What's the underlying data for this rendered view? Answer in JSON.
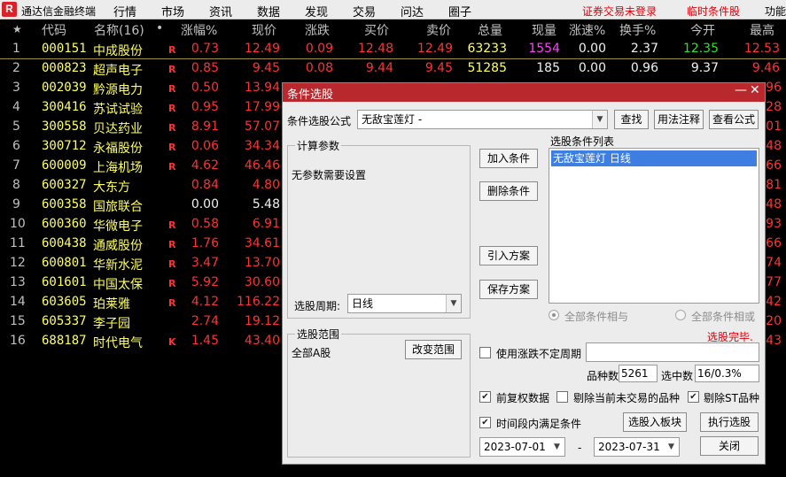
{
  "app": {
    "title": "通达信金融终端",
    "logo": "R",
    "menu": [
      "行情",
      "市场",
      "资讯",
      "数据",
      "发现",
      "交易",
      "问达",
      "圈子"
    ],
    "status_login": "证券交易未登录",
    "status_condition": "临时条件股",
    "func": "功能"
  },
  "table": {
    "columns": {
      "star": "★",
      "code": "代码",
      "name": "名称(16)",
      "dot": "•",
      "change_pct": "涨幅%",
      "price": "现价",
      "change": "涨跌",
      "bid": "买价",
      "ask": "卖价",
      "volume": "总量",
      "current_vol": "现量",
      "speed": "涨速%",
      "turnover": "换手%",
      "open": "今开",
      "high": "最高"
    },
    "rows": [
      {
        "idx": "1",
        "code": "000151",
        "name": "中成股份",
        "flag": "R",
        "pct": "0.73",
        "price": "12.49",
        "chg": "0.09",
        "bid": "12.48",
        "ask": "12.49",
        "vol": "63233",
        "cur": "1554",
        "speed": "0.00",
        "turn": "2.37",
        "open": "12.35",
        "high": "12.53"
      },
      {
        "idx": "2",
        "code": "000823",
        "name": "超声电子",
        "flag": "R",
        "pct": "0.85",
        "price": "9.45",
        "chg": "0.08",
        "bid": "9.44",
        "ask": "9.45",
        "vol": "51285",
        "cur": "185",
        "speed": "0.00",
        "turn": "0.96",
        "open": "9.37",
        "high": "9.46"
      },
      {
        "idx": "3",
        "code": "002039",
        "name": "黔源电力",
        "flag": "R",
        "pct": "0.50",
        "price": "13.94",
        "high": "96"
      },
      {
        "idx": "4",
        "code": "300416",
        "name": "苏试试验",
        "flag": "R",
        "pct": "0.95",
        "price": "17.99",
        "high": "28"
      },
      {
        "idx": "5",
        "code": "300558",
        "name": "贝达药业",
        "flag": "R",
        "pct": "8.91",
        "price": "57.07",
        "high": "01"
      },
      {
        "idx": "6",
        "code": "300712",
        "name": "永福股份",
        "flag": "R",
        "pct": "0.06",
        "price": "34.34",
        "high": "48"
      },
      {
        "idx": "7",
        "code": "600009",
        "name": "上海机场",
        "flag": "R",
        "pct": "4.62",
        "price": "46.46",
        "high": "66"
      },
      {
        "idx": "8",
        "code": "600327",
        "name": "大东方",
        "flag": "",
        "pct": "0.84",
        "price": "4.80",
        "high": "81"
      },
      {
        "idx": "9",
        "code": "600358",
        "name": "国旅联合",
        "flag": "",
        "pct": "0.00",
        "price": "5.48",
        "high": "48"
      },
      {
        "idx": "10",
        "code": "600360",
        "name": "华微电子",
        "flag": "R",
        "pct": "0.58",
        "price": "6.91",
        "high": "93"
      },
      {
        "idx": "11",
        "code": "600438",
        "name": "通威股份",
        "flag": "R",
        "pct": "1.76",
        "price": "34.61",
        "high": "66"
      },
      {
        "idx": "12",
        "code": "600801",
        "name": "华新水泥",
        "flag": "R",
        "pct": "3.47",
        "price": "13.70",
        "high": "74"
      },
      {
        "idx": "13",
        "code": "601601",
        "name": "中国太保",
        "flag": "R",
        "pct": "5.92",
        "price": "30.60",
        "high": "77"
      },
      {
        "idx": "14",
        "code": "603605",
        "name": "珀莱雅",
        "flag": "R",
        "pct": "4.12",
        "price": "116.22",
        "high": "42"
      },
      {
        "idx": "15",
        "code": "605337",
        "name": "李子园",
        "flag": "",
        "pct": "2.74",
        "price": "19.12",
        "high": "20"
      },
      {
        "idx": "16",
        "code": "688187",
        "name": "时代电气",
        "flag": "K",
        "pct": "1.45",
        "price": "43.40",
        "high": "43"
      }
    ]
  },
  "dialog": {
    "title": "条件选股",
    "minimize": "—",
    "close": "✕",
    "formula_label": "条件选股公式",
    "formula_value": "无敌宝莲灯   -",
    "search_btn": "查找",
    "usage_btn": "用法注释",
    "view_formula_btn": "查看公式",
    "calc_params_label": "计算参数",
    "no_params_text": "无参数需要设置",
    "period_label": "选股周期:",
    "period_value": "日线",
    "add_condition_btn": "加入条件",
    "delete_condition_btn": "删除条件",
    "import_scheme_btn": "引入方案",
    "save_scheme_btn": "保存方案",
    "condition_list_label": "选股条件列表",
    "condition_list": [
      "无敌宝莲灯  日线"
    ],
    "all_and_label": "全部条件相与",
    "all_or_label": "全部条件相或",
    "status_text": "选股完毕.",
    "range_label": "选股范围",
    "range_value": "全部A股",
    "change_range_btn": "改变范围",
    "use_period_label": "使用涨跌不定周期",
    "count_label": "品种数",
    "count_value": "5261",
    "selected_label": "选中数",
    "selected_value": "16/0.3%",
    "pre_adjust_label": "前复权数据",
    "exclude_untraded_label": "剔除当前未交易的品种",
    "exclude_st_label": "剔除ST品种",
    "time_period_label": "时间段内满足条件",
    "add_to_board_btn": "选股入板块",
    "execute_btn": "执行选股",
    "close_btn": "关闭",
    "date_from": "2023-07-01",
    "date_sep": "-",
    "date_to": "2023-07-31"
  }
}
